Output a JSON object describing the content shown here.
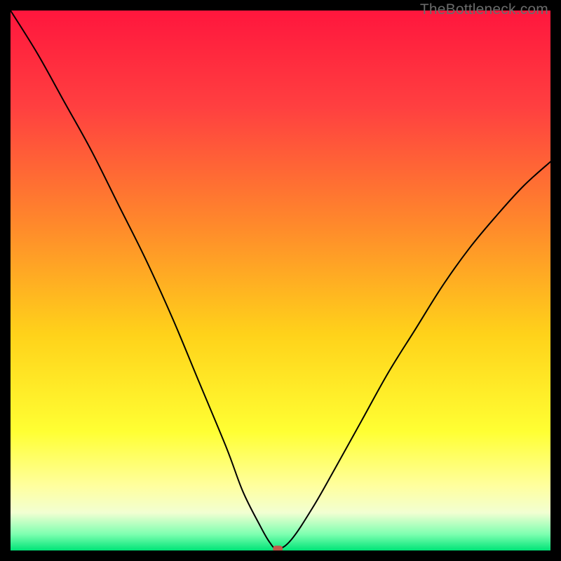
{
  "watermark": "TheBottleneck.com",
  "chart_data": {
    "type": "line",
    "title": "",
    "xlabel": "",
    "ylabel": "",
    "xlim": [
      0,
      100
    ],
    "ylim": [
      0,
      100
    ],
    "grid": false,
    "legend": false,
    "annotations": [],
    "background": {
      "type": "vertical-gradient",
      "stops": [
        {
          "pos": 0.0,
          "color": "#ff163d"
        },
        {
          "pos": 0.18,
          "color": "#ff4040"
        },
        {
          "pos": 0.4,
          "color": "#ff8a2b"
        },
        {
          "pos": 0.6,
          "color": "#ffd21a"
        },
        {
          "pos": 0.78,
          "color": "#ffff33"
        },
        {
          "pos": 0.88,
          "color": "#ffff9e"
        },
        {
          "pos": 0.93,
          "color": "#f2ffd2"
        },
        {
          "pos": 0.97,
          "color": "#7dffb0"
        },
        {
          "pos": 1.0,
          "color": "#00e477"
        }
      ]
    },
    "series": [
      {
        "name": "bottleneck-curve",
        "stroke": "#000000",
        "stroke_width": 2,
        "x": [
          0,
          5,
          10,
          15,
          20,
          25,
          30,
          35,
          40,
          43,
          46,
          48,
          49.5,
          52,
          56,
          60,
          65,
          70,
          75,
          80,
          85,
          90,
          95,
          100
        ],
        "values": [
          100,
          92,
          83,
          74,
          64,
          54,
          43,
          31,
          19,
          11,
          5,
          1.5,
          0.3,
          2,
          8,
          15,
          24,
          33,
          41,
          49,
          56,
          62,
          67.5,
          72
        ]
      }
    ],
    "marker": {
      "name": "min-point",
      "x": 49.5,
      "y": 0.3,
      "color": "#c1594a",
      "width": 1.8,
      "height": 1.2
    }
  }
}
